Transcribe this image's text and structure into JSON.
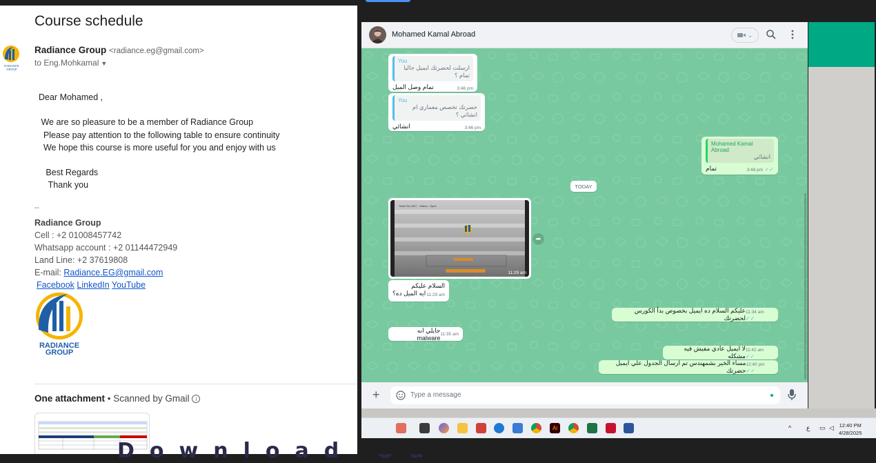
{
  "gmail": {
    "subject": "Course schedule",
    "sender_name": "Radiance Group",
    "sender_email": "<radiance.eg@gmail.com>",
    "to_line": "to Eng.Mohkamal",
    "greeting": "Dear Mohamed ,",
    "body_lines": [
      " We are so pleasure to be a member of Radiance Group",
      "  Please pay attention to the following table to ensure continuity",
      "  We hope this course is more useful for you and enjoy with us"
    ],
    "regards": "   Best Regards",
    "thanks": "    Thank you",
    "sig_dash": "--",
    "sig_company": "Radiance Group",
    "sig_cell": "Cell : +2 01008457742",
    "sig_whatsapp": "Whatsapp account : +2 01144472949",
    "sig_landline": "Land Line: +2 37619808",
    "sig_email_label": "E-mail: ",
    "sig_email_link": "Radiance.EG@gmail.com",
    "social": [
      "Facebook",
      "LinkedIn",
      "YouTube "
    ],
    "logo_text_line1": "RADIANCE",
    "logo_text_line2": "GROUP",
    "avatar_text": "RADIANCE GROUP",
    "attachment_title": "One attachment",
    "scanned_text": " • Scanned by Gmail",
    "bottom_overlay": "Download Ou"
  },
  "whatsapp": {
    "contact_name": "Mohamed Kamal Abroad",
    "today_label": "TODAY",
    "input_placeholder": "Type a message",
    "messages": [
      {
        "quote_name": "You",
        "quote_text": "ارسلت لحضرتك ايميل حاليا تمام ؟",
        "text": "تمام وصل الميل",
        "time": "3:46 pm"
      },
      {
        "quote_name": "You",
        "quote_text": "حضرتك تخصص معماري ام انشائي ؟",
        "text": "انشائي",
        "time": "3:46 pm"
      },
      {
        "quote_name": "Mohamed Kamal Abroad",
        "quote_text": "انشائي",
        "text": "تمام",
        "time": "3:48 pm"
      },
      {
        "text_line1": "السلام عليكم",
        "text_line2": "ايه الميل ده؟",
        "time": "11:29 am"
      },
      {
        "text": "عليكم السلام ده ايميل بخصوص بدأ الكورس لحضرتك",
        "time": "11:34 am"
      },
      {
        "text": "جايلي انه malware",
        "time": "11:35 am"
      },
      {
        "text": "لا ايميل عادي مفيش فيه مشكله",
        "time": "11:42 am"
      },
      {
        "text": "مساء الخير بشمهندس تم ارسال الجدول علي ايميل حضرتك",
        "time": "12:40 pm"
      }
    ],
    "image_time": "11:29 am",
    "image_caption_title": "Ticket No.2927 - Status : Open"
  },
  "taskbar": {
    "clock_time": "12:40 PM",
    "clock_date": "4/28/2025",
    "lang": "ع"
  },
  "colors": {
    "chat_bg": "#78c9a0",
    "accent_green": "#00a884",
    "link_blue": "#1155cc"
  }
}
